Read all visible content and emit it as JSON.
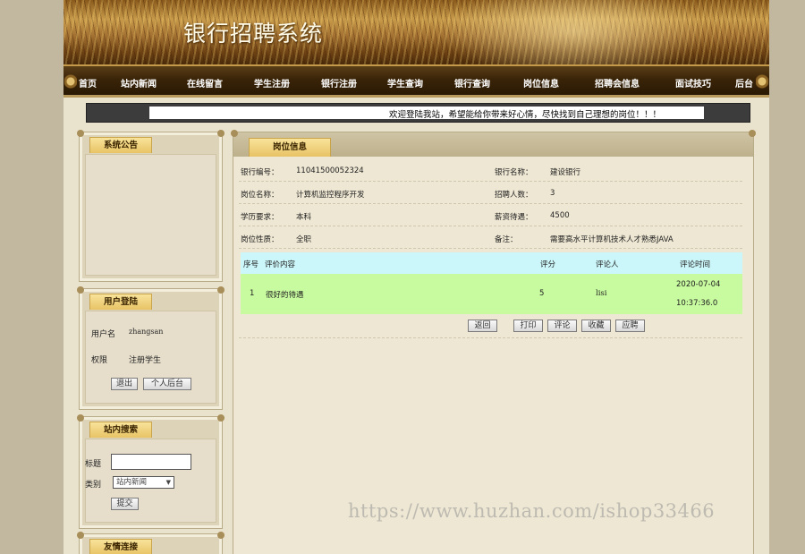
{
  "banner": {
    "title": "银行招聘系统"
  },
  "nav": [
    "首页",
    "站内新闻",
    "在线留言",
    "学生注册",
    "银行注册",
    "学生查询",
    "银行查询",
    "岗位信息",
    "招聘会信息",
    "面试技巧",
    "后台"
  ],
  "marquee": {
    "text": "欢迎登陆我站，希望能给你带来好心情，尽快找到自己理想的岗位！！！"
  },
  "sidebar": {
    "notice": {
      "title": "系统公告"
    },
    "login": {
      "title": "用户登陆",
      "username_label": "用户名",
      "username": "zhangsan",
      "role_label": "权限",
      "role": "注册学生",
      "logout_label": "退出",
      "personal_label": "个人后台"
    },
    "search": {
      "title": "站内搜索",
      "title_label": "标题",
      "title_value": "",
      "category_label": "类别",
      "category_selected": "站内新闻",
      "submit_label": "提交"
    },
    "links": {
      "title": "友情连接"
    }
  },
  "main": {
    "tab_title": "岗位信息",
    "fields": {
      "bank_no_label": "银行编号：",
      "bank_no": "11041500052324",
      "bank_name_label": "银行名称：",
      "bank_name": "建设银行",
      "position_label": "岗位名称：",
      "position": "计算机监控程序开发",
      "count_label": "招聘人数：",
      "count": "3",
      "edu_label": "学历要求：",
      "edu": "本科",
      "salary_label": "薪资待遇：",
      "salary": "4500",
      "nature_label": "岗位性质：",
      "nature": "全职",
      "remark_label": "备注：",
      "remark": "需要高水平计算机技术人才熟悉JAVA"
    },
    "comments": {
      "headers": {
        "no": "序号",
        "content": "评价内容",
        "score": "评分",
        "user": "评论人",
        "time": "评论时间"
      },
      "rows": [
        {
          "no": "1",
          "content": "很好的待遇",
          "score": "5",
          "user": "lisi",
          "date": "2020-07-04",
          "time": "10:37:36.0"
        }
      ]
    },
    "buttons": {
      "back": "返回",
      "print": "打印",
      "comment": "评论",
      "favorite": "收藏",
      "apply": "应聘"
    }
  },
  "watermark": "https://www.huzhan.com/ishop33466"
}
